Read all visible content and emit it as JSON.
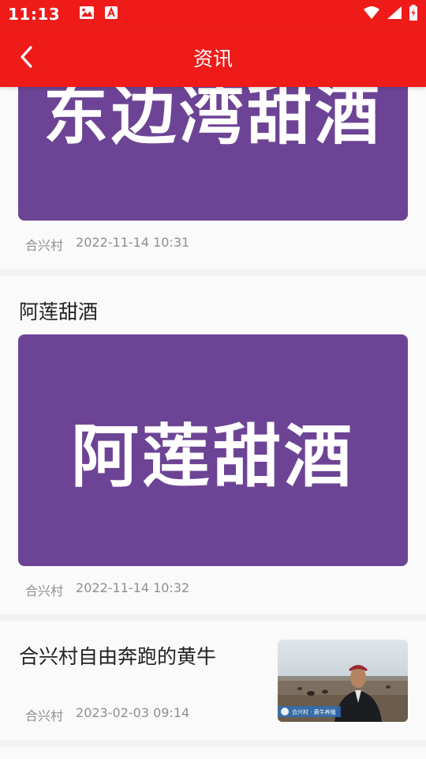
{
  "status_bar": {
    "time": "11:13",
    "icons": [
      "image-icon",
      "font-icon",
      "wifi-icon",
      "signal-icon",
      "battery-charging-icon"
    ]
  },
  "app_bar": {
    "title": "资讯",
    "back_icon": "chevron-left-icon"
  },
  "articles": [
    {
      "banner_text": "东边湾甜酒",
      "source": "合兴村",
      "date": "2022-11-14 10:31"
    },
    {
      "title": "阿莲甜酒",
      "banner_text": "阿莲甜酒",
      "source": "合兴村",
      "date": "2022-11-14 10:32"
    },
    {
      "title": "合兴村自由奔跑的黄牛",
      "thumbnail_caption": "合兴村 · 黄牛养殖",
      "source": "合兴村",
      "date": "2023-02-03 09:14"
    }
  ],
  "colors": {
    "accent": "#ee1b19",
    "banner": "#6d4495",
    "meta_text": "#8f8f8f"
  }
}
